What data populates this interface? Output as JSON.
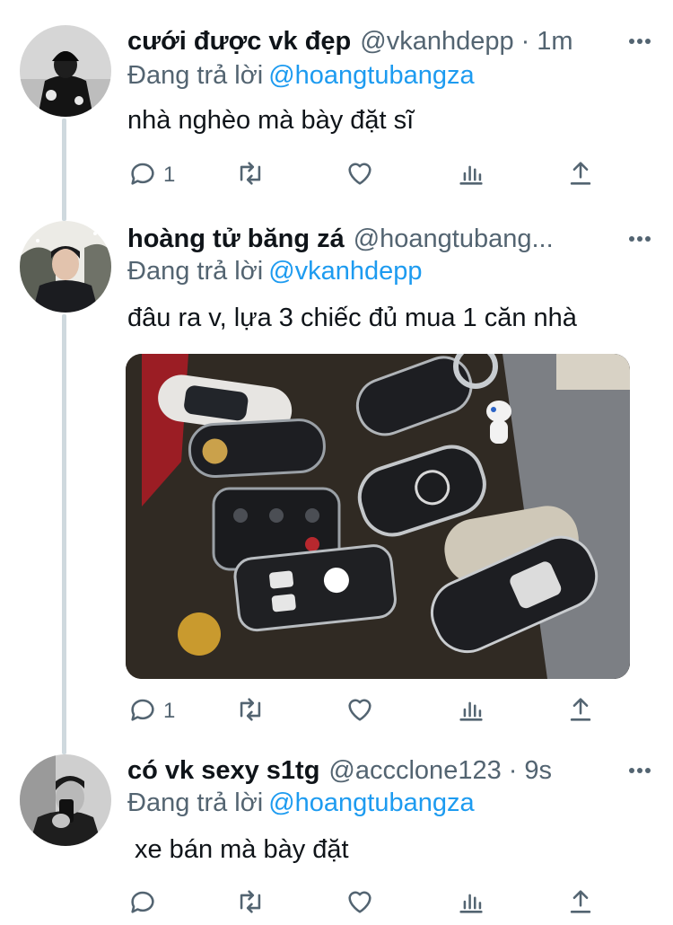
{
  "tweets": [
    {
      "display_name": "cưới được vk đẹp",
      "handle": "@vkanhdepp",
      "separator": "·",
      "time": "1m",
      "reply_prefix": "Đang trả lời",
      "reply_to": "@hoangtubangza",
      "text": "nhà nghèo mà bày đặt sĩ",
      "reply_count": "1",
      "retweet_count": "",
      "like_count": ""
    },
    {
      "display_name": "hoàng tử băng zá",
      "handle": "@hoangtubang...",
      "reply_prefix": "Đang trả lời",
      "reply_to": "@vkanhdepp",
      "text": "đâu ra v, lựa 3 chiếc đủ mua 1 căn nhà",
      "reply_count": "1",
      "retweet_count": "",
      "like_count": ""
    },
    {
      "display_name": "có vk sexy s1tg",
      "handle": "@accclone123",
      "separator": "·",
      "time": "9s",
      "reply_prefix": "Đang trả lời",
      "reply_to": "@hoangtubangza",
      "text": "xe bán mà bày đặt",
      "reply_count": "",
      "retweet_count": "",
      "like_count": ""
    }
  ],
  "colors": {
    "link": "#1d9bf0",
    "secondary_text": "#536471",
    "primary_text": "#0f1419",
    "thread_line": "#cfd9de"
  },
  "icons": [
    "reply-icon",
    "retweet-icon",
    "like-icon",
    "analytics-icon",
    "share-icon",
    "more-icon"
  ]
}
